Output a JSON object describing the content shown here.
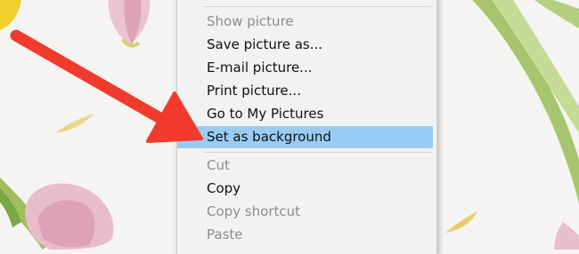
{
  "context_menu": {
    "items": [
      {
        "label": "Show picture",
        "enabled": false
      },
      {
        "label": "Save picture as...",
        "enabled": true
      },
      {
        "label": "E-mail picture...",
        "enabled": true
      },
      {
        "label": "Print picture...",
        "enabled": true
      },
      {
        "label": "Go to My Pictures",
        "enabled": true
      },
      {
        "label": "Set as background",
        "enabled": true,
        "highlighted": true
      },
      {
        "label": "Cut",
        "enabled": false
      },
      {
        "label": "Copy",
        "enabled": true
      },
      {
        "label": "Copy shortcut",
        "enabled": false
      },
      {
        "label": "Paste",
        "enabled": false
      }
    ]
  },
  "colors": {
    "highlight": "#99ccf5",
    "arrow": "#f03b2c",
    "menu_background": "#f2f2f2",
    "disabled_text": "#8c8c8c"
  },
  "annotation": {
    "icon": "arrow-icon",
    "points_to": "Set as background"
  }
}
